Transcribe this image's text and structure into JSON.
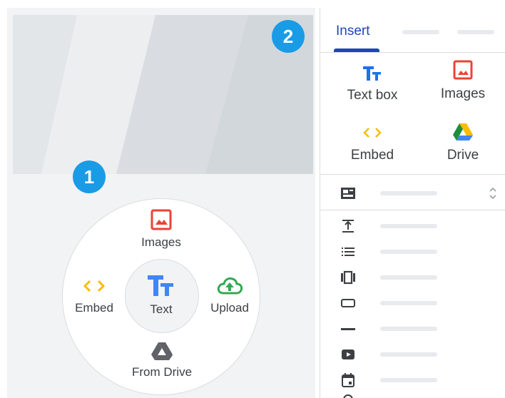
{
  "badges": {
    "one": "1",
    "two": "2"
  },
  "radial_menu": {
    "images_label": "Images",
    "embed_label": "Embed",
    "text_label": "Text",
    "upload_label": "Upload",
    "drive_label": "From Drive"
  },
  "panel": {
    "tabs": [
      {
        "label": "Insert",
        "selected": true
      }
    ],
    "grid": [
      {
        "icon": "text-box-icon",
        "label": "Text box"
      },
      {
        "icon": "image-icon",
        "label": "Images"
      },
      {
        "icon": "embed-icon",
        "label": "Embed"
      },
      {
        "icon": "drive-icon",
        "label": "Drive"
      }
    ],
    "rows": [
      {
        "icon": "layout-icon"
      },
      {
        "icon": "collapsible-text-icon"
      },
      {
        "icon": "list-icon"
      },
      {
        "icon": "carousel-icon"
      },
      {
        "icon": "button-icon"
      },
      {
        "icon": "divider-icon"
      },
      {
        "icon": "youtube-icon"
      },
      {
        "icon": "calendar-icon"
      },
      {
        "icon": "map-icon"
      }
    ]
  },
  "colors": {
    "accent_blue": "#1a47b8",
    "badge_blue": "#1a9be6",
    "text_icon_blue": "#4285f4",
    "image_red": "#ea4335",
    "embed_yellow": "#fbbc04",
    "upload_green": "#34a853"
  }
}
